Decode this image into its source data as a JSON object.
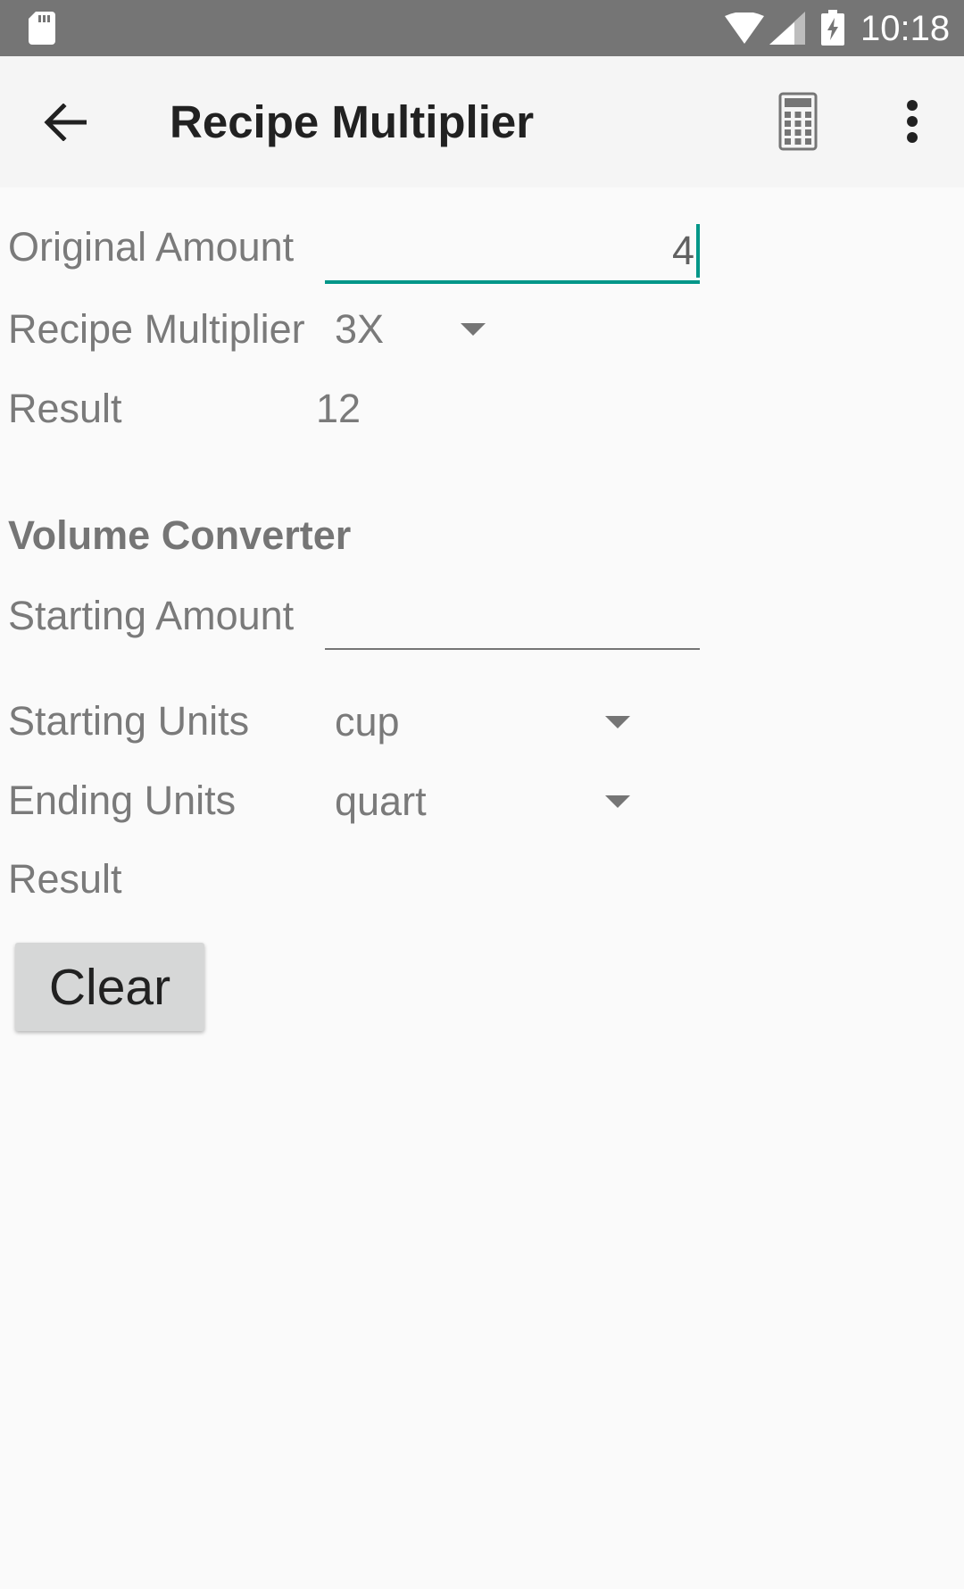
{
  "status_bar": {
    "time": "10:18",
    "icons": [
      "sd-card-icon",
      "wifi-icon",
      "cell-signal-icon",
      "battery-charging-icon"
    ]
  },
  "app_bar": {
    "title": "Recipe Multiplier",
    "back_icon": "arrow-back-icon",
    "calculator_icon": "calculator-icon",
    "more_icon": "more-vert-icon"
  },
  "recipe": {
    "original_amount_label": "Original Amount",
    "original_amount_value": "4",
    "multiplier_label": "Recipe Multiplier",
    "multiplier_value": "3X",
    "result_label": "Result",
    "result_value": "12"
  },
  "volume": {
    "section_title": "Volume Converter",
    "starting_amount_label": "Starting Amount",
    "starting_amount_value": "",
    "starting_units_label": "Starting Units",
    "starting_units_value": "cup",
    "ending_units_label": "Ending Units",
    "ending_units_value": "quart",
    "result_label": "Result",
    "result_value": ""
  },
  "actions": {
    "clear_label": "Clear"
  },
  "colors": {
    "status_bar": "#757575",
    "app_bar": "#f5f5f5",
    "background": "#fafafa",
    "accent": "#009688",
    "button": "#d6d7d7"
  }
}
